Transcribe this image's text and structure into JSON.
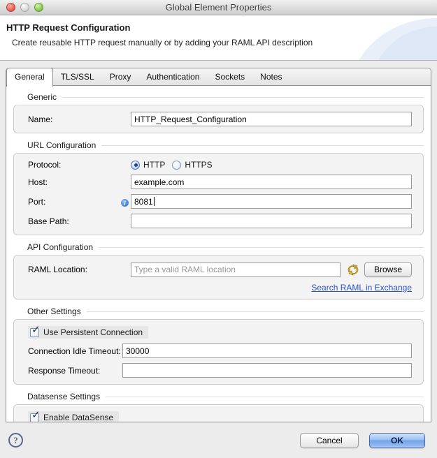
{
  "window": {
    "title": "Global Element Properties"
  },
  "header": {
    "title": "HTTP Request Configuration",
    "subtitle": "Create reusable HTTP request manually or by adding your RAML API description"
  },
  "tabs": [
    "General",
    "TLS/SSL",
    "Proxy",
    "Authentication",
    "Sockets",
    "Notes"
  ],
  "selected_tab": "General",
  "generic": {
    "title": "Generic",
    "name_label": "Name:",
    "name_value": "HTTP_Request_Configuration"
  },
  "url": {
    "title": "URL Configuration",
    "protocol_label": "Protocol:",
    "http_label": "HTTP",
    "https_label": "HTTPS",
    "protocol_selected": "HTTP",
    "host_label": "Host:",
    "host_value": "example.com",
    "port_label": "Port:",
    "port_value": "8081",
    "base_path_label": "Base Path:",
    "base_path_value": ""
  },
  "api": {
    "title": "API Configuration",
    "raml_label": "RAML Location:",
    "raml_placeholder": "Type a valid RAML location",
    "raml_value": "",
    "browse_label": "Browse",
    "link_label": "Search RAML in Exchange"
  },
  "other": {
    "title": "Other Settings",
    "persistent_label": "Use Persistent Connection",
    "persistent_checked": true,
    "idle_label": "Connection Idle Timeout:",
    "idle_value": "30000",
    "response_label": "Response Timeout:",
    "response_value": ""
  },
  "datasense": {
    "title": "Datasense Settings",
    "enable_label": "Enable DataSense",
    "enable_checked": true
  },
  "footer": {
    "help_label": "?",
    "cancel_label": "Cancel",
    "ok_label": "OK"
  },
  "icons": {
    "check_glyph": "✓",
    "info_glyph": "i",
    "help_glyph": "?",
    "sync_icon_name": "raml-sync-icon"
  },
  "colors": {
    "ok_button_blue": "#72a3e9",
    "link_blue": "#2a52c8",
    "info_badge_blue": "#3f7fd6",
    "sync_gold": "#cfa42b",
    "traffic_red": "#ee6a5e",
    "traffic_green": "#8ed155"
  }
}
